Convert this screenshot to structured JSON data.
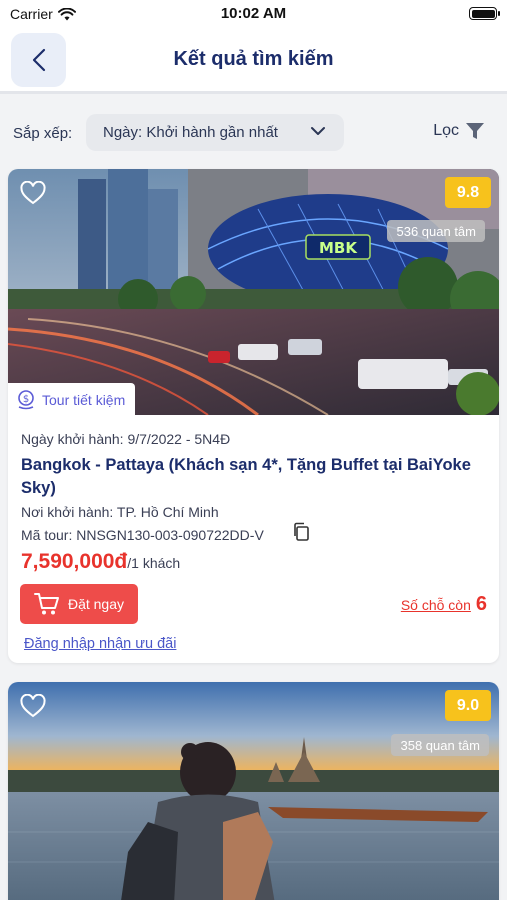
{
  "status_bar": {
    "carrier": "Carrier",
    "time": "10:02 AM"
  },
  "header": {
    "title": "Kết quả tìm kiếm"
  },
  "sort": {
    "label": "Sắp xếp:",
    "value": "Ngày: Khởi hành gần nhất"
  },
  "filter": {
    "label": "Lọc"
  },
  "tours": [
    {
      "score": "9.8",
      "interest": "536 quan tâm",
      "badge": "Tour tiết kiệm",
      "date": "Ngày khởi hành: 9/7/2022 - 5N4Đ",
      "name": "Bangkok - Pattaya (Khách sạn 4*, Tặng Buffet tại BaiYoke Sky)",
      "origin": "Nơi khởi hành: TP. Hồ Chí Minh",
      "code": "Mã tour: NNSGN130-003-090722DD-V",
      "price": "7,590,000đ",
      "per": "/1 khách",
      "book_label": "Đặt ngay",
      "seats_label": "Số chỗ còn",
      "seats": "6",
      "login_label": "Đăng nhập nhận ưu đãi",
      "photo_sign": "MBK"
    },
    {
      "score": "9.0",
      "interest": "358 quan tâm"
    }
  ],
  "colors": {
    "accent": "#1c2d6b",
    "price": "#e8332c",
    "score": "#f7c21c",
    "book": "#ee4c4a",
    "link": "#4a56c8"
  }
}
